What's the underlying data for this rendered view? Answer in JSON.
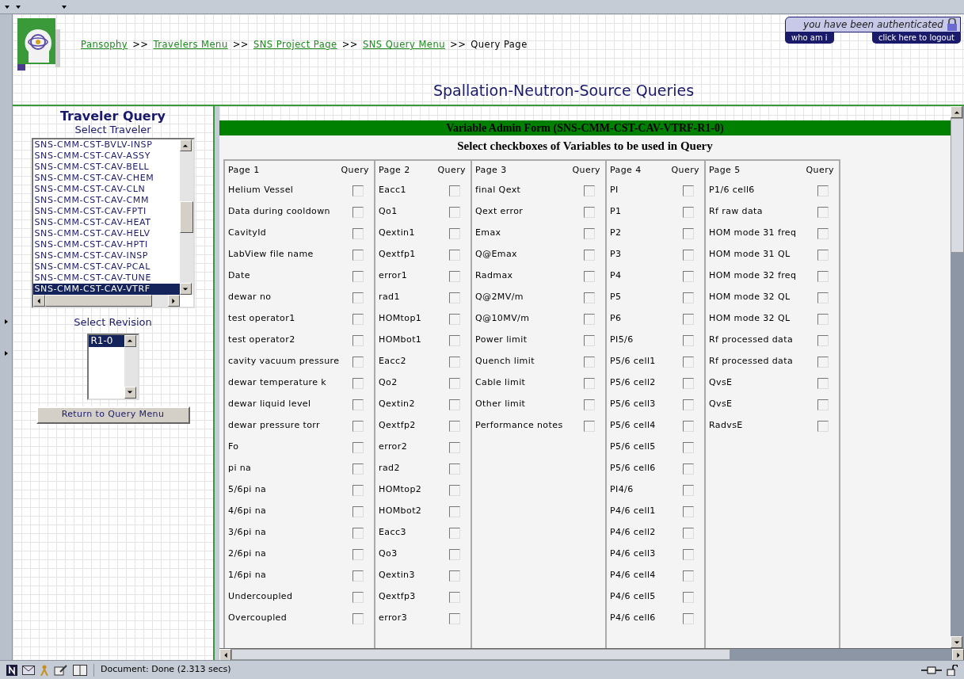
{
  "breadcrumb": [
    {
      "text": "Pansophy",
      "kind": "link"
    },
    {
      "text": ">>",
      "kind": "separator"
    },
    {
      "text": "Travelers Menu",
      "kind": "link"
    },
    {
      "text": ">>",
      "kind": "separator"
    },
    {
      "text": "SNS Project Page",
      "kind": "link"
    },
    {
      "text": ">>",
      "kind": "separator"
    },
    {
      "text": "SNS Query Menu",
      "kind": "link"
    },
    {
      "text": ">>",
      "kind": "separator"
    },
    {
      "text": "Query Page",
      "kind": "current"
    }
  ],
  "auth": {
    "message": "you have been authenticated",
    "buttons": [
      "who am i",
      "click here to logout"
    ]
  },
  "page_title": "Spallation-Neutron-Source Queries",
  "sidebar": {
    "title": "Traveler Query",
    "traveler_label": "Select Traveler",
    "travelers": [
      {
        "text": "SNS-CMM-CST-BVLV-INSP",
        "selected": false
      },
      {
        "text": "SNS-CMM-CST-CAV-ASSY",
        "selected": false
      },
      {
        "text": "SNS-CMM-CST-CAV-BELL",
        "selected": false
      },
      {
        "text": "SNS-CMM-CST-CAV-CHEM",
        "selected": false
      },
      {
        "text": "SNS-CMM-CST-CAV-CLN",
        "selected": false
      },
      {
        "text": "SNS-CMM-CST-CAV-CMM",
        "selected": false
      },
      {
        "text": "SNS-CMM-CST-CAV-FPTI",
        "selected": false
      },
      {
        "text": "SNS-CMM-CST-CAV-HEAT",
        "selected": false
      },
      {
        "text": "SNS-CMM-CST-CAV-HELV",
        "selected": false
      },
      {
        "text": "SNS-CMM-CST-CAV-HPTI",
        "selected": false
      },
      {
        "text": "SNS-CMM-CST-CAV-INSP",
        "selected": false
      },
      {
        "text": "SNS-CMM-CST-CAV-PCAL",
        "selected": false
      },
      {
        "text": "SNS-CMM-CST-CAV-TUNE",
        "selected": false
      },
      {
        "text": "SNS-CMM-CST-CAV-VTRF",
        "selected": true
      }
    ],
    "revision_label": "Select Revision",
    "revisions": [
      {
        "text": "R1-0",
        "selected": true
      }
    ],
    "return_button": "Return to Query Menu"
  },
  "form": {
    "title": "Variable Admin Form (SNS-CMM-CST-CAV-VTRF-R1-0)",
    "subtitle": "Select checkboxes of Variables to be used in Query",
    "pages": [
      {
        "title": "Page 1",
        "query_header": "Query",
        "variables": [
          {
            "label": "Helium Vessel",
            "checked": false
          },
          {
            "label": "Data during cooldown",
            "checked": false
          },
          {
            "label": "CavityId",
            "checked": false
          },
          {
            "label": "LabView file name",
            "checked": false
          },
          {
            "label": "Date",
            "checked": false
          },
          {
            "label": "dewar no",
            "checked": false
          },
          {
            "label": "test operator1",
            "checked": false
          },
          {
            "label": "test operator2",
            "checked": false
          },
          {
            "label": "cavity vacuum pressure",
            "checked": false
          },
          {
            "label": "dewar temperature k",
            "checked": false
          },
          {
            "label": "dewar liquid level",
            "checked": false
          },
          {
            "label": "dewar pressure torr",
            "checked": false
          },
          {
            "label": "Fo",
            "checked": false
          },
          {
            "label": "pi na",
            "checked": false
          },
          {
            "label": "5/6pi na",
            "checked": false
          },
          {
            "label": "4/6pi na",
            "checked": false
          },
          {
            "label": "3/6pi na",
            "checked": false
          },
          {
            "label": "2/6pi na",
            "checked": false
          },
          {
            "label": "1/6pi na",
            "checked": false
          },
          {
            "label": "Undercoupled",
            "checked": false
          },
          {
            "label": "Overcoupled",
            "checked": false
          }
        ]
      },
      {
        "title": "Page 2",
        "query_header": "Query",
        "variables": [
          {
            "label": "Eacc1",
            "checked": false
          },
          {
            "label": "Qo1",
            "checked": false
          },
          {
            "label": "Qextin1",
            "checked": false
          },
          {
            "label": "Qextfp1",
            "checked": false
          },
          {
            "label": "error1",
            "checked": false
          },
          {
            "label": "rad1",
            "checked": false
          },
          {
            "label": "HOMtop1",
            "checked": false
          },
          {
            "label": "HOMbot1",
            "checked": false
          },
          {
            "label": "Eacc2",
            "checked": false
          },
          {
            "label": "Qo2",
            "checked": false
          },
          {
            "label": "Qextin2",
            "checked": false
          },
          {
            "label": "Qextfp2",
            "checked": false
          },
          {
            "label": "error2",
            "checked": false
          },
          {
            "label": "rad2",
            "checked": false
          },
          {
            "label": "HOMtop2",
            "checked": false
          },
          {
            "label": "HOMbot2",
            "checked": false
          },
          {
            "label": "Eacc3",
            "checked": false
          },
          {
            "label": "Qo3",
            "checked": false
          },
          {
            "label": "Qextin3",
            "checked": false
          },
          {
            "label": "Qextfp3",
            "checked": false
          },
          {
            "label": "error3",
            "checked": false
          }
        ]
      },
      {
        "title": "Page 3",
        "query_header": "Query",
        "variables": [
          {
            "label": "final Qext",
            "checked": false
          },
          {
            "label": "Qext error",
            "checked": false
          },
          {
            "label": "Emax",
            "checked": false
          },
          {
            "label": "Q@Emax",
            "checked": false
          },
          {
            "label": "Radmax",
            "checked": false
          },
          {
            "label": "Q@2MV/m",
            "checked": false
          },
          {
            "label": "Q@10MV/m",
            "checked": false
          },
          {
            "label": "Power limit",
            "checked": false
          },
          {
            "label": "Quench limit",
            "checked": false
          },
          {
            "label": "Cable limit",
            "checked": false
          },
          {
            "label": "Other limit",
            "checked": false
          },
          {
            "label": "Performance notes",
            "checked": false
          }
        ]
      },
      {
        "title": "Page 4",
        "query_header": "Query",
        "variables": [
          {
            "label": "PI",
            "checked": false
          },
          {
            "label": "P1",
            "checked": false
          },
          {
            "label": "P2",
            "checked": false
          },
          {
            "label": "P3",
            "checked": false
          },
          {
            "label": "P4",
            "checked": false
          },
          {
            "label": "P5",
            "checked": false
          },
          {
            "label": "P6",
            "checked": false
          },
          {
            "label": "PI5/6",
            "checked": false
          },
          {
            "label": "P5/6 cell1",
            "checked": false
          },
          {
            "label": "P5/6 cell2",
            "checked": false
          },
          {
            "label": "P5/6 cell3",
            "checked": false
          },
          {
            "label": "P5/6 cell4",
            "checked": false
          },
          {
            "label": "P5/6 cell5",
            "checked": false
          },
          {
            "label": "P5/6 cell6",
            "checked": false
          },
          {
            "label": "PI4/6",
            "checked": false
          },
          {
            "label": "P4/6 cell1",
            "checked": false
          },
          {
            "label": "P4/6 cell2",
            "checked": false
          },
          {
            "label": "P4/6 cell3",
            "checked": false
          },
          {
            "label": "P4/6 cell4",
            "checked": false
          },
          {
            "label": "P4/6 cell5",
            "checked": false
          },
          {
            "label": "P4/6 cell6",
            "checked": false
          }
        ]
      },
      {
        "title": "Page 5",
        "query_header": "Query",
        "variables": [
          {
            "label": "P1/6 cell6",
            "checked": false
          },
          {
            "label": "Rf raw data",
            "checked": false
          },
          {
            "label": "HOM mode 31 freq",
            "checked": false
          },
          {
            "label": "HOM mode 31 QL",
            "checked": false
          },
          {
            "label": "HOM mode 32 freq",
            "checked": false
          },
          {
            "label": "HOM mode 32 QL",
            "checked": false
          },
          {
            "label": "HOM mode 32 QL",
            "checked": false
          },
          {
            "label": "Rf processed data",
            "checked": false
          },
          {
            "label": "Rf processed data",
            "checked": false
          },
          {
            "label": "QvsE",
            "checked": false
          },
          {
            "label": "QvsE",
            "checked": false
          },
          {
            "label": "RadvsE",
            "checked": false
          }
        ]
      }
    ]
  },
  "status_bar": {
    "text": "Document: Done (2.313 secs)"
  }
}
